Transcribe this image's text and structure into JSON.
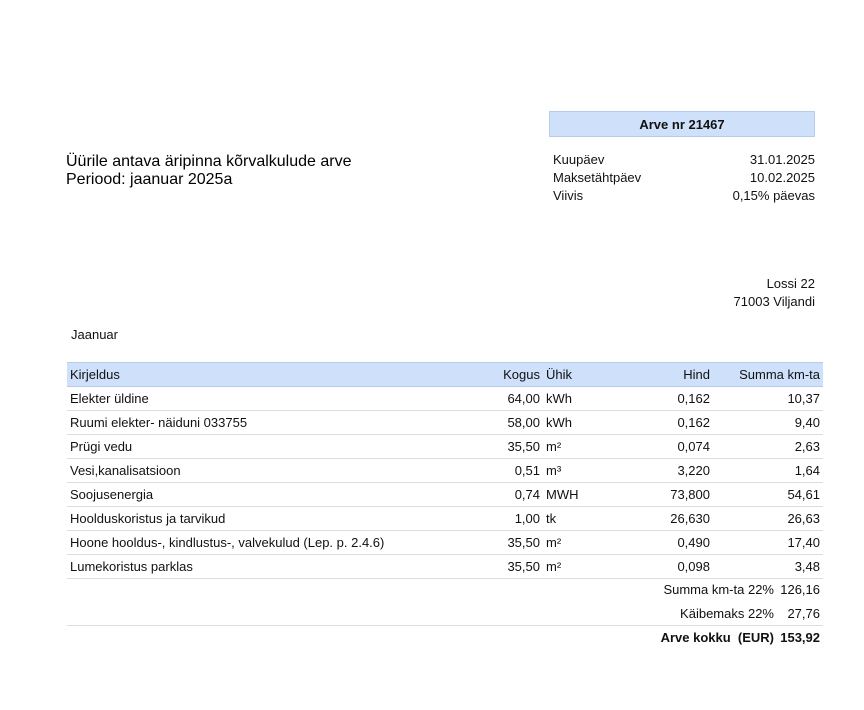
{
  "document": {
    "title_line1": "Üürile antava äripinna kõrvalkulude arve",
    "title_line2": "Periood: jaanuar 2025a"
  },
  "invoice": {
    "number_label": "Arve nr 21467",
    "meta": [
      {
        "label": "Kuupäev",
        "value": "31.01.2025"
      },
      {
        "label": "Maksetähtpäev",
        "value": "10.02.2025"
      },
      {
        "label": "Viivis",
        "value": "0,15% päevas"
      }
    ]
  },
  "address": {
    "street": "Lossi 22",
    "city": "71003 Viljandi"
  },
  "month_label": "Jaanuar",
  "table": {
    "headers": {
      "description": "Kirjeldus",
      "quantity": "Kogus",
      "unit": "Ühik",
      "price": "Hind",
      "sum": "Summa km-ta"
    },
    "rows": [
      {
        "description": "Elekter üldine",
        "quantity": "64,00",
        "unit": "kWh",
        "price": "0,162",
        "sum": "10,37"
      },
      {
        "description": "Ruumi elekter-  näiduni 033755",
        "quantity": "58,00",
        "unit": "kWh",
        "price": "0,162",
        "sum": "9,40"
      },
      {
        "description": "Prügi vedu",
        "quantity": "35,50",
        "unit": "m²",
        "price": "0,074",
        "sum": "2,63"
      },
      {
        "description": "Vesi,kanalisatsioon",
        "quantity": "0,51",
        "unit": "m³",
        "price": "3,220",
        "sum": "1,64"
      },
      {
        "description": "Soojusenergia",
        "quantity": "0,74",
        "unit": "MWH",
        "price": "73,800",
        "sum": "54,61"
      },
      {
        "description": "Hoolduskoristus ja tarvikud",
        "quantity": "1,00",
        "unit": "tk",
        "price": "26,630",
        "sum": "26,63"
      },
      {
        "description": "Hoone hooldus-, kindlustus-, valvekulud (Lep. p. 2.4.6)",
        "quantity": "35,50",
        "unit": "m²",
        "price": "0,490",
        "sum": "17,40"
      },
      {
        "description": "Lumekoristus parklas",
        "quantity": "35,50",
        "unit": "m²",
        "price": "0,098",
        "sum": "3,48"
      }
    ]
  },
  "totals": {
    "subtotal_label": "Summa km-ta 22%",
    "subtotal_value": "126,16",
    "vat_label": "Käibemaks 22%",
    "vat_value": "27,76",
    "grand_label": "Arve kokku  (EUR)",
    "grand_value": "153,92"
  }
}
